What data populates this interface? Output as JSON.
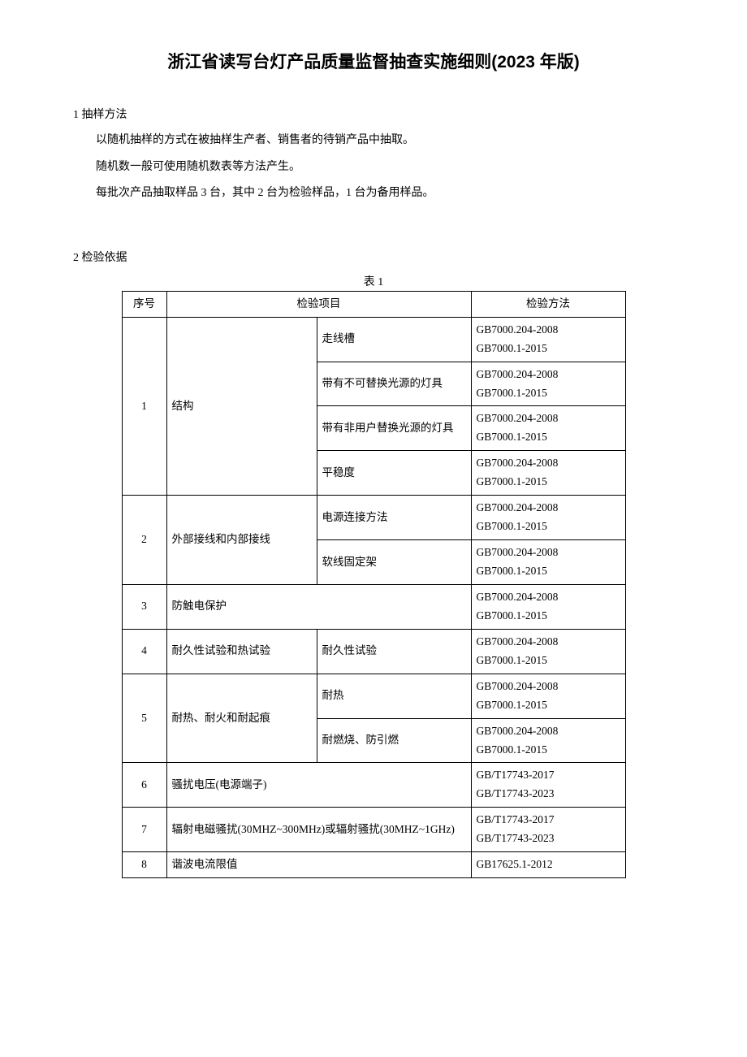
{
  "title": "浙江省读写台灯产品质量监督抽查实施细则(2023 年版)",
  "section1": {
    "heading": "1 抽样方法",
    "p1": "以随机抽样的方式在被抽样生产者、销售者的待销产品中抽取。",
    "p2": "随机数一般可使用随机数表等方法产生。",
    "p3": "每批次产品抽取样品 3 台，其中 2 台为检验样品，1 台为备用样品。"
  },
  "section2": {
    "heading": "2 检验依据",
    "table_caption": "表 1",
    "headers": {
      "no": "序号",
      "item": "检验项目",
      "method": "检验方法"
    },
    "rows": [
      {
        "no": "1",
        "item": "结构",
        "subs": [
          {
            "name": "走线槽",
            "methods": [
              "GB7000.204-2008",
              "GB7000.1-2015"
            ]
          },
          {
            "name": "带有不可替换光源的灯具",
            "methods": [
              "GB7000.204-2008",
              "GB7000.1-2015"
            ]
          },
          {
            "name": "带有非用户替换光源的灯具",
            "methods": [
              "GB7000.204-2008",
              "GB7000.1-2015"
            ]
          },
          {
            "name": "平稳度",
            "methods": [
              "GB7000.204-2008",
              "GB7000.1-2015"
            ]
          }
        ]
      },
      {
        "no": "2",
        "item": "外部接线和内部接线",
        "subs": [
          {
            "name": "电源连接方法",
            "methods": [
              "GB7000.204-2008",
              "GB7000.1-2015"
            ]
          },
          {
            "name": "软线固定架",
            "methods": [
              "GB7000.204-2008",
              "GB7000.1-2015"
            ]
          }
        ]
      },
      {
        "no": "3",
        "item": "防触电保护",
        "subs": [
          {
            "name": "",
            "methods": [
              "GB7000.204-2008",
              "GB7000.1-2015"
            ]
          }
        ]
      },
      {
        "no": "4",
        "item": "耐久性试验和热试验",
        "subs": [
          {
            "name": "耐久性试验",
            "methods": [
              "GB7000.204-2008",
              "GB7000.1-2015"
            ]
          }
        ]
      },
      {
        "no": "5",
        "item": "耐热、耐火和耐起痕",
        "subs": [
          {
            "name": "耐热",
            "methods": [
              "GB7000.204-2008",
              "GB7000.1-2015"
            ]
          },
          {
            "name": "耐燃烧、防引燃",
            "methods": [
              "GB7000.204-2008",
              "GB7000.1-2015"
            ]
          }
        ]
      },
      {
        "no": "6",
        "item": "骚扰电压(电源端子)",
        "subs": [
          {
            "name": "",
            "methods": [
              "GB/T17743-2017",
              "GB/T17743-2023"
            ]
          }
        ]
      },
      {
        "no": "7",
        "item": "辐射电磁骚扰(30MHZ~300MHz)或辐射骚扰(30MHZ~1GHz)",
        "subs": [
          {
            "name": "",
            "methods": [
              "GB/T17743-2017",
              "GB/T17743-2023"
            ]
          }
        ]
      },
      {
        "no": "8",
        "item": "谐波电流限值",
        "subs": [
          {
            "name": "",
            "methods": [
              "GB17625.1-2012"
            ]
          }
        ]
      }
    ]
  }
}
